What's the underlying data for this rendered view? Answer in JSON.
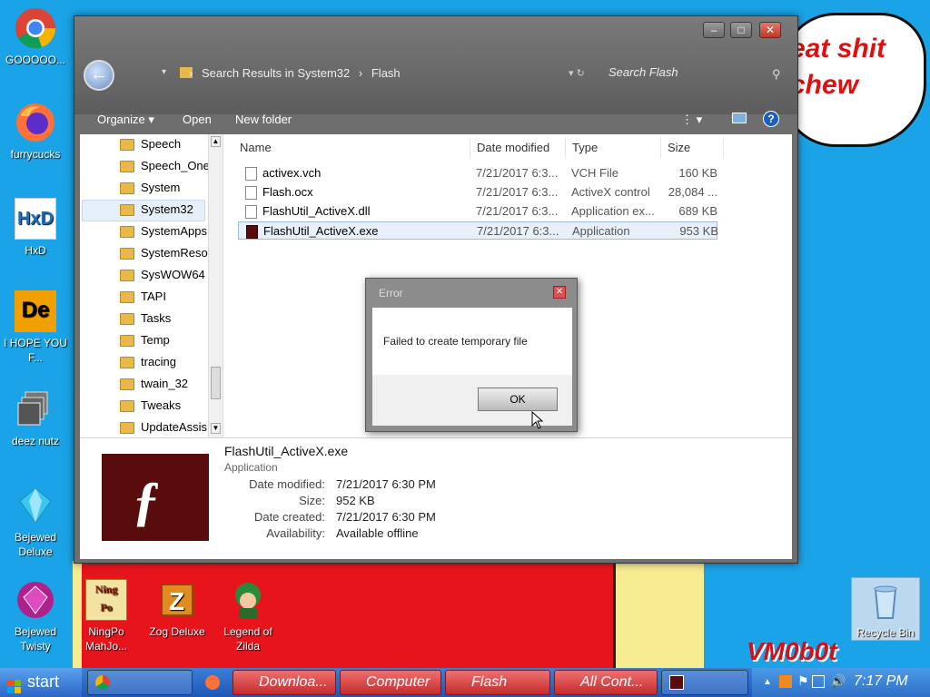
{
  "desktop": {
    "icons": [
      {
        "label": "GOOOOO...",
        "icon": "chrome-icon"
      },
      {
        "label": "furrycucks",
        "icon": "firefox-icon"
      },
      {
        "label": "HxD",
        "icon": "hxd-icon"
      },
      {
        "label": "I HOPE YOU F...",
        "icon": "de-icon"
      },
      {
        "label": "deez nutz",
        "icon": "copy-icon"
      },
      {
        "label": "Bejewed Deluxe",
        "icon": "gem-icon"
      },
      {
        "label": "Bejewed Twisty",
        "icon": "twist-gem-icon"
      },
      {
        "label": "NingPo MahJo...",
        "icon": "ningpo-icon"
      },
      {
        "label": "Zog Deluxe",
        "icon": "zog-icon"
      },
      {
        "label": "Legend of Zilda",
        "icon": "zilda-icon"
      },
      {
        "label": "Recycle Bin",
        "icon": "recycle-bin-icon"
      }
    ],
    "bubble_text": "eat shit chew",
    "watermark": "VM0b0t"
  },
  "explorer": {
    "breadcrumb": [
      "Search Results in System32",
      "Flash"
    ],
    "search_placeholder": "Search Flash",
    "toolbar": {
      "organize": "Organize",
      "open": "Open",
      "new_folder": "New folder"
    },
    "nav_items": [
      "Speech",
      "Speech_One",
      "System",
      "System32",
      "SystemApps",
      "SystemResou",
      "SysWOW64",
      "TAPI",
      "Tasks",
      "Temp",
      "tracing",
      "twain_32",
      "Tweaks",
      "UpdateAssis"
    ],
    "selected_nav": "System32",
    "columns": [
      "Name",
      "Date modified",
      "Type",
      "Size"
    ],
    "files": [
      {
        "name": "activex.vch",
        "date": "7/21/2017 6:3...",
        "type": "VCH File",
        "size": "160 KB"
      },
      {
        "name": "Flash.ocx",
        "date": "7/21/2017 6:3...",
        "type": "ActiveX control",
        "size": "28,084 ..."
      },
      {
        "name": "FlashUtil_ActiveX.dll",
        "date": "7/21/2017 6:3...",
        "type": "Application ex...",
        "size": "689 KB"
      },
      {
        "name": "FlashUtil_ActiveX.exe",
        "date": "7/21/2017 6:3...",
        "type": "Application",
        "size": "953 KB"
      }
    ],
    "details": {
      "filename": "FlashUtil_ActiveX.exe",
      "kind": "Application",
      "date_modified_label": "Date modified:",
      "date_modified": "7/21/2017 6:30 PM",
      "size_label": "Size:",
      "size": "952 KB",
      "date_created_label": "Date created:",
      "date_created": "7/21/2017 6:30 PM",
      "availability_label": "Availability:",
      "availability": "Available offline"
    }
  },
  "dialog": {
    "title": "Error",
    "message": "Failed to create temporary file",
    "ok": "OK"
  },
  "taskbar": {
    "start": "start",
    "buttons": [
      "Downloa...",
      "Computer",
      "Flash",
      "All Cont..."
    ],
    "clock": "7:17 PM"
  }
}
